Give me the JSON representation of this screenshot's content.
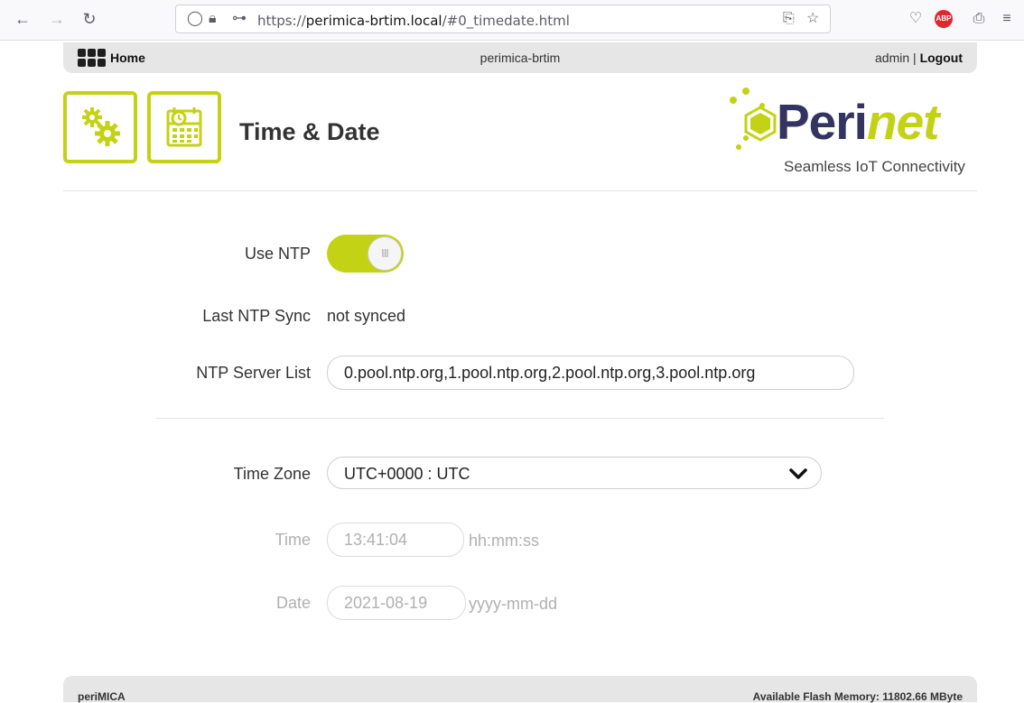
{
  "browser": {
    "url_prefix": "https://",
    "url_host": "perimica-brtim.local",
    "url_path": "/#0_timedate.html",
    "abp_label": "ABP"
  },
  "nav": {
    "home_label": "Home",
    "host_label": "perimica-brtim",
    "user": "admin",
    "separator": "|",
    "logout_label": "Logout"
  },
  "header": {
    "title": "Time & Date",
    "logo_main": "Peri",
    "logo_accent": "net",
    "logo_tagline": "Seamless IoT Connectivity"
  },
  "form": {
    "use_ntp_label": "Use NTP",
    "use_ntp_enabled": true,
    "toggle_glyph": "III",
    "last_sync_label": "Last NTP Sync",
    "last_sync_value": "not synced",
    "server_list_label": "NTP Server List",
    "server_list_value": "0.pool.ntp.org,1.pool.ntp.org,2.pool.ntp.org,3.pool.ntp.org",
    "timezone_label": "Time Zone",
    "timezone_value": "UTC+0000 : UTC",
    "time_label": "Time",
    "time_value": "13:41:04",
    "time_hint": "hh:mm:ss",
    "date_label": "Date",
    "date_value": "2021-08-19",
    "date_hint": "yyyy-mm-dd"
  },
  "footer": {
    "left": "periMICA",
    "right": "Available Flash Memory: 11802.66 MByte"
  },
  "colors": {
    "accent": "#c3d214",
    "brand_dark": "#33345f"
  }
}
